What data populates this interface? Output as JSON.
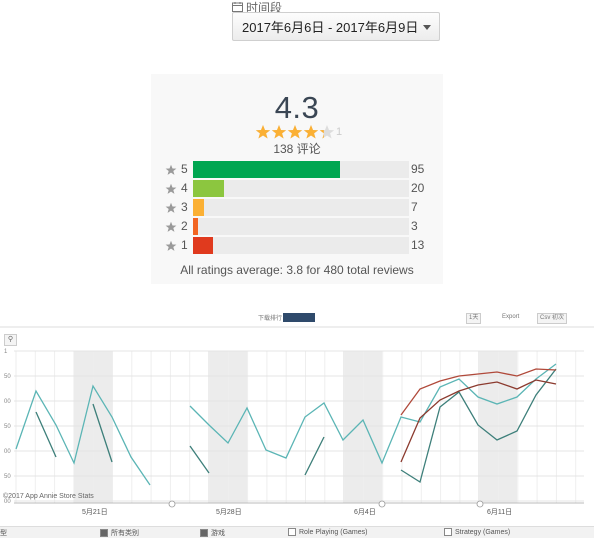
{
  "date_range": {
    "label": "时间段",
    "value": "2017年6月6日 - 2017年6月9日"
  },
  "ratings": {
    "average": "4.3",
    "stars_suffix": "1",
    "review_count": "138 评论",
    "rows": [
      {
        "level": "5",
        "count": "95",
        "fraction": 0.68,
        "color": "#00a651"
      },
      {
        "level": "4",
        "count": "20",
        "fraction": 0.145,
        "color": "#8cc63f"
      },
      {
        "level": "3",
        "count": "7",
        "fraction": 0.051,
        "color": "#fbb034"
      },
      {
        "level": "2",
        "count": "3",
        "fraction": 0.022,
        "color": "#f26522"
      },
      {
        "level": "1",
        "count": "13",
        "fraction": 0.094,
        "color": "#e03a1e"
      }
    ],
    "footer": "All ratings average: 3.8 for 480 total reviews",
    "star_color": "#fbb034"
  },
  "chart": {
    "watermark": "©2017 App Annie Store Stats",
    "x_ticks": [
      "5月21日",
      "5月28日",
      "6月4日",
      "6月11日"
    ],
    "y_tick_labels": [
      "1",
      "50",
      "00",
      "50",
      "00",
      "50",
      "00"
    ],
    "toolbar_label": "下载排行",
    "toolbar_dark": "",
    "toolbar_right": [
      "1天",
      "Export",
      "Csv 初次"
    ],
    "legend": [
      {
        "label": "所有类别",
        "checked": true
      },
      {
        "label": "游戏",
        "checked": true
      },
      {
        "label": "Role Playing (Games)",
        "checked": false
      },
      {
        "label": "Strategy (Games)",
        "checked": false
      }
    ],
    "colors": {
      "teal": "#5bb5b5",
      "dark_teal": "#3d7f7a",
      "red": "#b0493a",
      "dark_red": "#8b3a2e"
    }
  }
}
